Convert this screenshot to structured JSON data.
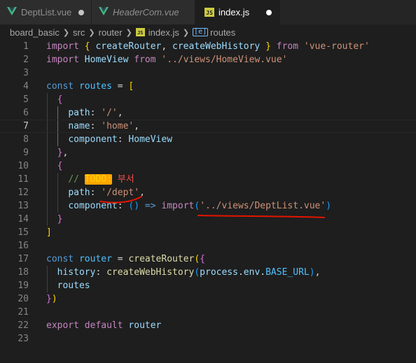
{
  "tabs": [
    {
      "label": "DeptList.vue",
      "icon": "vue-icon",
      "dirty": true,
      "active": false,
      "italic": false
    },
    {
      "label": "HeaderCom.vue",
      "icon": "vue-icon",
      "dirty": false,
      "active": false,
      "italic": true
    },
    {
      "label": "index.js",
      "icon": "js-file-icon",
      "dirty": true,
      "active": true,
      "italic": false
    }
  ],
  "breadcrumb": {
    "items": [
      "board_basic",
      "src",
      "router",
      "index.js",
      "routes"
    ],
    "js_badge": "JS"
  },
  "editor": {
    "current_line": 7,
    "line_numbers": [
      "1",
      "2",
      "3",
      "4",
      "5",
      "6",
      "7",
      "8",
      "9",
      "10",
      "11",
      "12",
      "13",
      "14",
      "15",
      "16",
      "17",
      "18",
      "19",
      "20",
      "21",
      "22",
      "23"
    ],
    "lines": [
      [
        [
          "kw",
          "import"
        ],
        [
          "p",
          " "
        ],
        [
          "b1",
          "{"
        ],
        [
          "p",
          " "
        ],
        [
          "prop",
          "createRouter"
        ],
        [
          "p",
          ", "
        ],
        [
          "prop",
          "createWebHistory"
        ],
        [
          "p",
          " "
        ],
        [
          "b1",
          "}"
        ],
        [
          "p",
          " "
        ],
        [
          "kw",
          "from"
        ],
        [
          "p",
          " "
        ],
        [
          "str",
          "'vue-router'"
        ]
      ],
      [
        [
          "kw",
          "import"
        ],
        [
          "p",
          " "
        ],
        [
          "prop",
          "HomeView"
        ],
        [
          "p",
          " "
        ],
        [
          "kw",
          "from"
        ],
        [
          "p",
          " "
        ],
        [
          "str",
          "'../views/HomeView.vue'"
        ]
      ],
      [],
      [
        [
          "st",
          "const"
        ],
        [
          "p",
          " "
        ],
        [
          "var",
          "routes"
        ],
        [
          "p",
          " = "
        ],
        [
          "b1",
          "["
        ]
      ],
      [
        [
          "p",
          "  "
        ],
        [
          "b2",
          "{"
        ]
      ],
      [
        [
          "p",
          "    "
        ],
        [
          "prop",
          "path"
        ],
        [
          "p",
          ": "
        ],
        [
          "str",
          "'/'"
        ],
        [
          "p",
          ","
        ]
      ],
      [
        [
          "p",
          "    "
        ],
        [
          "prop",
          "name"
        ],
        [
          "p",
          ": "
        ],
        [
          "str",
          "'home'"
        ],
        [
          "p",
          ","
        ]
      ],
      [
        [
          "p",
          "    "
        ],
        [
          "prop",
          "component"
        ],
        [
          "p",
          ": "
        ],
        [
          "prop",
          "HomeView"
        ]
      ],
      [
        [
          "p",
          "  "
        ],
        [
          "b2",
          "}"
        ],
        [
          "p",
          ","
        ]
      ],
      [
        [
          "p",
          "  "
        ],
        [
          "b2",
          "{"
        ]
      ],
      [
        [
          "p",
          "    "
        ],
        [
          "cm",
          "// "
        ],
        [
          "todo",
          "TODO:"
        ],
        [
          "cm",
          " "
        ],
        [
          "ko",
          "부서"
        ]
      ],
      [
        [
          "p",
          "    "
        ],
        [
          "prop",
          "path"
        ],
        [
          "p",
          ": "
        ],
        [
          "str",
          "'/dept'"
        ],
        [
          "p",
          ","
        ]
      ],
      [
        [
          "p",
          "    "
        ],
        [
          "prop",
          "component"
        ],
        [
          "p",
          ": "
        ],
        [
          "b3",
          "()"
        ],
        [
          "p",
          " "
        ],
        [
          "st",
          "=>"
        ],
        [
          "p",
          " "
        ],
        [
          "kw",
          "import"
        ],
        [
          "b3",
          "("
        ],
        [
          "str",
          "'../views/DeptList.vue'"
        ],
        [
          "b3",
          ")"
        ]
      ],
      [
        [
          "p",
          "  "
        ],
        [
          "b2",
          "}"
        ]
      ],
      [
        [
          "b1",
          "]"
        ]
      ],
      [],
      [
        [
          "st",
          "const"
        ],
        [
          "p",
          " "
        ],
        [
          "var",
          "router"
        ],
        [
          "p",
          " = "
        ],
        [
          "fn",
          "createRouter"
        ],
        [
          "b1",
          "("
        ],
        [
          "b2",
          "{"
        ]
      ],
      [
        [
          "p",
          "  "
        ],
        [
          "prop",
          "history"
        ],
        [
          "p",
          ": "
        ],
        [
          "fn",
          "createWebHistory"
        ],
        [
          "b3",
          "("
        ],
        [
          "prop",
          "process"
        ],
        [
          "p",
          "."
        ],
        [
          "prop",
          "env"
        ],
        [
          "p",
          "."
        ],
        [
          "var",
          "BASE_URL"
        ],
        [
          "b3",
          ")"
        ],
        [
          "p",
          ","
        ]
      ],
      [
        [
          "p",
          "  "
        ],
        [
          "prop",
          "routes"
        ]
      ],
      [
        [
          "b2",
          "}"
        ],
        [
          "b1",
          ")"
        ]
      ],
      [],
      [
        [
          "kw",
          "export"
        ],
        [
          "p",
          " "
        ],
        [
          "kw",
          "default"
        ],
        [
          "p",
          " "
        ],
        [
          "prop",
          "router"
        ]
      ],
      []
    ]
  },
  "colors": {
    "background": "#1e1e1e",
    "annotation": "#e51400"
  }
}
